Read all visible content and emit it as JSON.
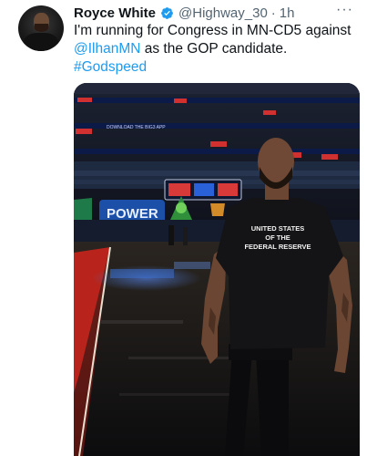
{
  "tweet": {
    "author_name": "Royce White",
    "author_handle": "@Highway_30",
    "separator": "·",
    "timestamp": "1h",
    "more_label": "···",
    "text_line1": "I'm running for Congress in MN-CD5 against",
    "mention": "@IlhanMN",
    "text_line2_rest": " as the GOP candidate.",
    "hashtag": "#Godspeed"
  },
  "media": {
    "shirt_line1": "UNITED STATES",
    "shirt_line2": "OF THE",
    "shirt_line3": "FEDERAL RESERVE",
    "sign_power": "POWER",
    "ribbon_text": "DOWNLOAD THE BIG3 APP"
  },
  "colors": {
    "link": "#1d9bf0",
    "verified": "#1d9bf0",
    "court_red": "#b8241c",
    "arena_blue": "#1b4fa8"
  },
  "icons": {
    "verified": "verified-badge-icon",
    "more": "more-dots-icon"
  }
}
